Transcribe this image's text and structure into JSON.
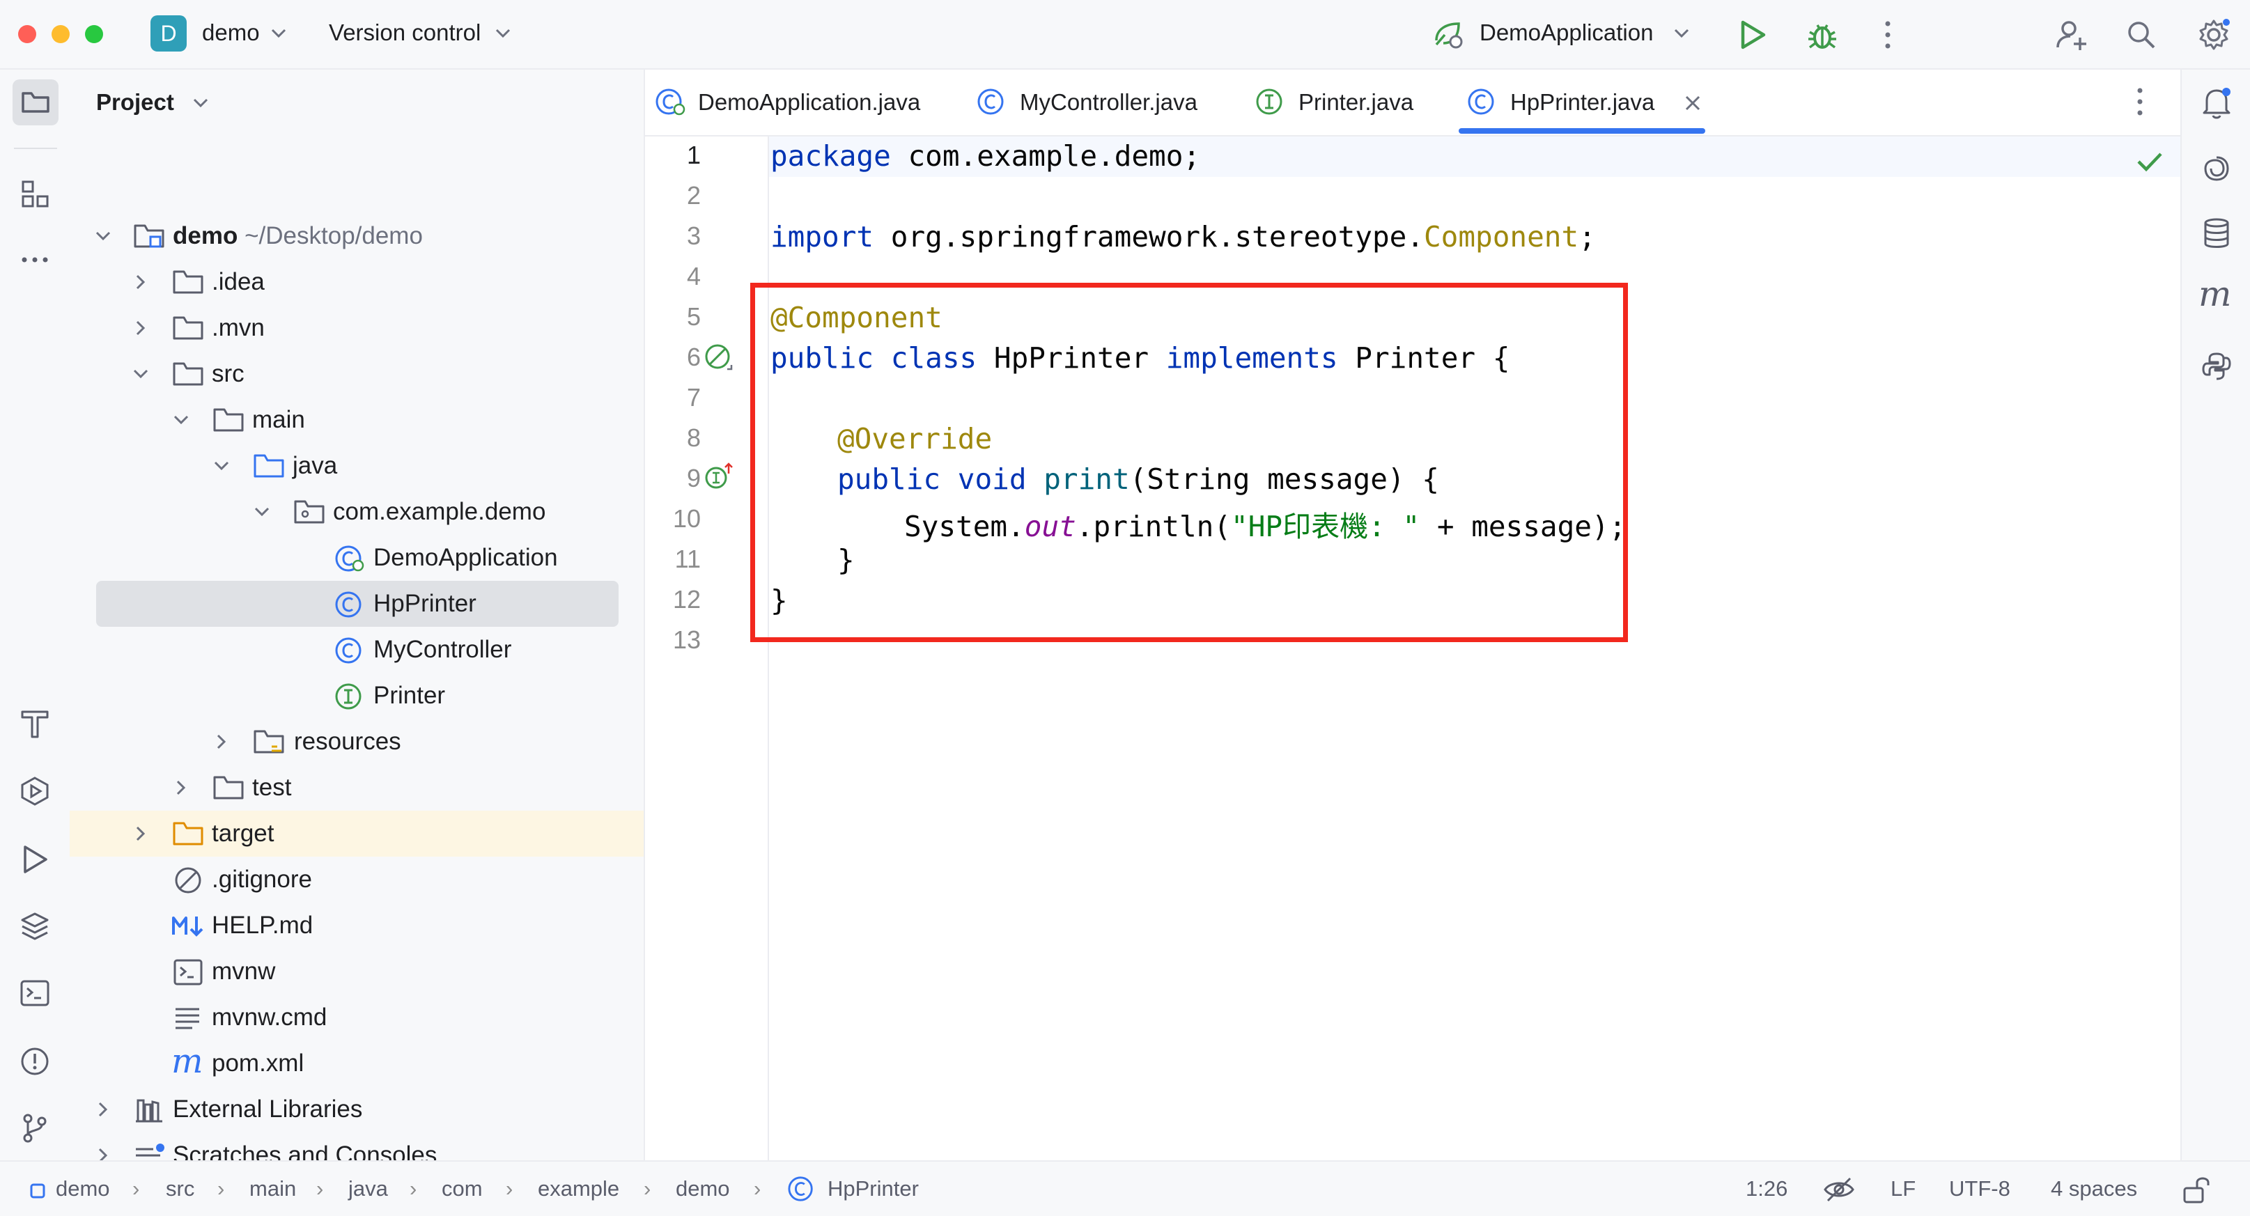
{
  "titlebar": {
    "project_badge": "D",
    "project_name": "demo",
    "version_control": "Version control",
    "run_config": "DemoApplication"
  },
  "project_panel": {
    "title": "Project",
    "tree": [
      {
        "label": "demo",
        "sub": "~/Desktop/demo",
        "icon": "module-folder-icon"
      },
      {
        "label": ".idea",
        "icon": "folder-icon"
      },
      {
        "label": ".mvn",
        "icon": "folder-icon"
      },
      {
        "label": "src",
        "icon": "folder-icon"
      },
      {
        "label": "main",
        "icon": "folder-icon"
      },
      {
        "label": "java",
        "icon": "source-folder-icon"
      },
      {
        "label": "com.example.demo",
        "icon": "package-icon"
      },
      {
        "label": "DemoApplication",
        "icon": "spring-class-icon"
      },
      {
        "label": "HpPrinter",
        "icon": "class-icon"
      },
      {
        "label": "MyController",
        "icon": "class-icon"
      },
      {
        "label": "Printer",
        "icon": "interface-icon"
      },
      {
        "label": "resources",
        "icon": "resources-folder-icon"
      },
      {
        "label": "test",
        "icon": "folder-icon"
      },
      {
        "label": "target",
        "icon": "excluded-folder-icon"
      },
      {
        "label": ".gitignore",
        "icon": "ignore-file-icon"
      },
      {
        "label": "HELP.md",
        "icon": "markdown-icon"
      },
      {
        "label": "mvnw",
        "icon": "shell-script-icon"
      },
      {
        "label": "mvnw.cmd",
        "icon": "text-file-icon"
      },
      {
        "label": "pom.xml",
        "icon": "maven-icon"
      },
      {
        "label": "External Libraries",
        "icon": "libraries-icon"
      },
      {
        "label": "Scratches and Consoles",
        "icon": "scratches-icon"
      }
    ]
  },
  "tabs": [
    {
      "label": "DemoApplication.java",
      "icon": "spring-class-icon"
    },
    {
      "label": "MyController.java",
      "icon": "class-icon"
    },
    {
      "label": "Printer.java",
      "icon": "interface-icon"
    },
    {
      "label": "HpPrinter.java",
      "icon": "class-icon",
      "active": true
    }
  ],
  "editor": {
    "line_numbers": [
      "1",
      "2",
      "3",
      "4",
      "5",
      "6",
      "7",
      "8",
      "9",
      "10",
      "11",
      "12",
      "13"
    ],
    "code": {
      "l1_kw": "package",
      "l1_rest": " com.example.demo;",
      "l3_kw": "import",
      "l3_pkg": " org.springframework.stereotype.",
      "l3_cls": "Component",
      "l3_end": ";",
      "l5_ann": "@Component",
      "l6_kw": "public class",
      "l6_name": " HpPrinter ",
      "l6_impl": "implements",
      "l6_rest": " Printer {",
      "l8_ann": "@Override",
      "l9_kw": "public void",
      "l9_method": "print",
      "l9_rest": "(String message) {",
      "l10_sys": "System.",
      "l10_out": "out",
      "l10_call": ".println(",
      "l10_str": "\"HP印表機: \"",
      "l10_rest": " + message);",
      "l11": "}",
      "l12": "}"
    }
  },
  "statusbar": {
    "breadcrumb": [
      "demo",
      "src",
      "main",
      "java",
      "com",
      "example",
      "demo",
      "HpPrinter"
    ],
    "position": "1:26",
    "line_separator": "LF",
    "encoding": "UTF-8",
    "indent": "4 spaces"
  },
  "colors": {
    "accent": "#3574f0",
    "highlight_box": "#f2281e",
    "keyword": "#0033b3",
    "annotation": "#9e880d",
    "string": "#067d17"
  }
}
